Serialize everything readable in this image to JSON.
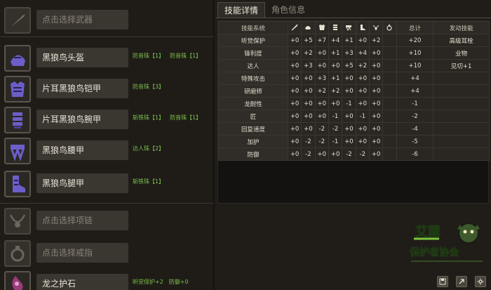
{
  "equipment": [
    {
      "slot": "weapon",
      "icon": "weapon-slot-icon",
      "name": "点击选择武器",
      "empty": true,
      "jewels": []
    },
    {
      "slot": "head",
      "icon": "helmet-icon",
      "name": "黑狼鸟头盔",
      "empty": false,
      "jewels": [
        "防音珠【1】",
        "防音珠【1】"
      ]
    },
    {
      "slot": "chest",
      "icon": "chest-armor-icon",
      "name": "片耳黑狼鸟铠甲",
      "empty": false,
      "jewels": [
        "防音珠【3】"
      ]
    },
    {
      "slot": "arms",
      "icon": "arm-armor-icon",
      "name": "片耳黑狼鸟腕甲",
      "empty": false,
      "jewels": [
        "斩铁珠【1】",
        "防音珠【1】"
      ]
    },
    {
      "slot": "waist",
      "icon": "waist-armor-icon",
      "name": "黑狼鸟腰甲",
      "empty": false,
      "jewels": [
        "达人珠【2】"
      ]
    },
    {
      "slot": "legs",
      "icon": "leg-armor-icon",
      "name": "黑狼鸟腿甲",
      "empty": false,
      "jewels": [
        "斩铁珠【1】"
      ]
    },
    {
      "slot": "necklace",
      "icon": "necklace-slot-icon",
      "name": "点击选择项链",
      "empty": true,
      "jewels": []
    },
    {
      "slot": "ring",
      "icon": "ring-slot-icon",
      "name": "点击选择戒指",
      "empty": true,
      "jewels": []
    },
    {
      "slot": "charm",
      "icon": "charm-icon",
      "name": "龙之护石",
      "empty": false,
      "jewels": [
        "听觉保护+2",
        "防御+0"
      ]
    }
  ],
  "tabs": [
    {
      "label": "技能详情",
      "active": true
    },
    {
      "label": "角色信息",
      "active": false
    }
  ],
  "skill_table": {
    "headers": {
      "skill": "技能系统",
      "part_icons": [
        "weapon-icon",
        "helmet-icon",
        "chest-armor-icon",
        "arm-armor-icon",
        "waist-armor-icon",
        "leg-armor-icon",
        "necklace-icon",
        "ring-icon"
      ],
      "total": "总计",
      "activated": "发动技能"
    },
    "rows": [
      {
        "skill": "听觉保护",
        "values": [
          "+0",
          "+5",
          "+7",
          "+4",
          "+1",
          "+0",
          "+2"
        ],
        "total": "+20",
        "activated": "高级耳栓"
      },
      {
        "skill": "锋利度",
        "values": [
          "+0",
          "+2",
          "+0",
          "+1",
          "+3",
          "+4",
          "+0"
        ],
        "total": "+10",
        "activated": "业物"
      },
      {
        "skill": "达人",
        "values": [
          "+0",
          "+3",
          "+0",
          "+0",
          "+5",
          "+2",
          "+0"
        ],
        "total": "+10",
        "activated": "见切+1"
      },
      {
        "skill": "特殊攻击",
        "values": [
          "+0",
          "+0",
          "+3",
          "+1",
          "+0",
          "+0",
          "+0"
        ],
        "total": "+4",
        "activated": ""
      },
      {
        "skill": "研磨师",
        "values": [
          "+0",
          "+0",
          "+2",
          "+2",
          "+0",
          "+0",
          "+0"
        ],
        "total": "+4",
        "activated": ""
      },
      {
        "skill": "龙耐性",
        "values": [
          "+0",
          "+0",
          "+0",
          "+0",
          "-1",
          "+0",
          "+0"
        ],
        "total": "-1",
        "activated": ""
      },
      {
        "skill": "匠",
        "values": [
          "+0",
          "+0",
          "+0",
          "-1",
          "+0",
          "-1",
          "+0"
        ],
        "total": "-2",
        "activated": ""
      },
      {
        "skill": "回复速度",
        "values": [
          "+0",
          "+0",
          "-2",
          "-2",
          "+0",
          "+0",
          "+0"
        ],
        "total": "-4",
        "activated": ""
      },
      {
        "skill": "加护",
        "values": [
          "+0",
          "-2",
          "-2",
          "-1",
          "+0",
          "+0",
          "+0"
        ],
        "total": "-5",
        "activated": ""
      },
      {
        "skill": "防御",
        "values": [
          "+0",
          "-2",
          "+0",
          "+0",
          "-2",
          "-2",
          "+0"
        ],
        "total": "-6",
        "activated": ""
      }
    ]
  },
  "logo": {
    "title": "艾露",
    "subtitle": "保护者协会"
  },
  "bottom_buttons": [
    "save-icon",
    "share-icon",
    "settings-icon"
  ],
  "colors": {
    "jewel_text": "#7cc24a",
    "placeholder_text": "#8a857a",
    "accent_purple": "#7c6ad0"
  }
}
